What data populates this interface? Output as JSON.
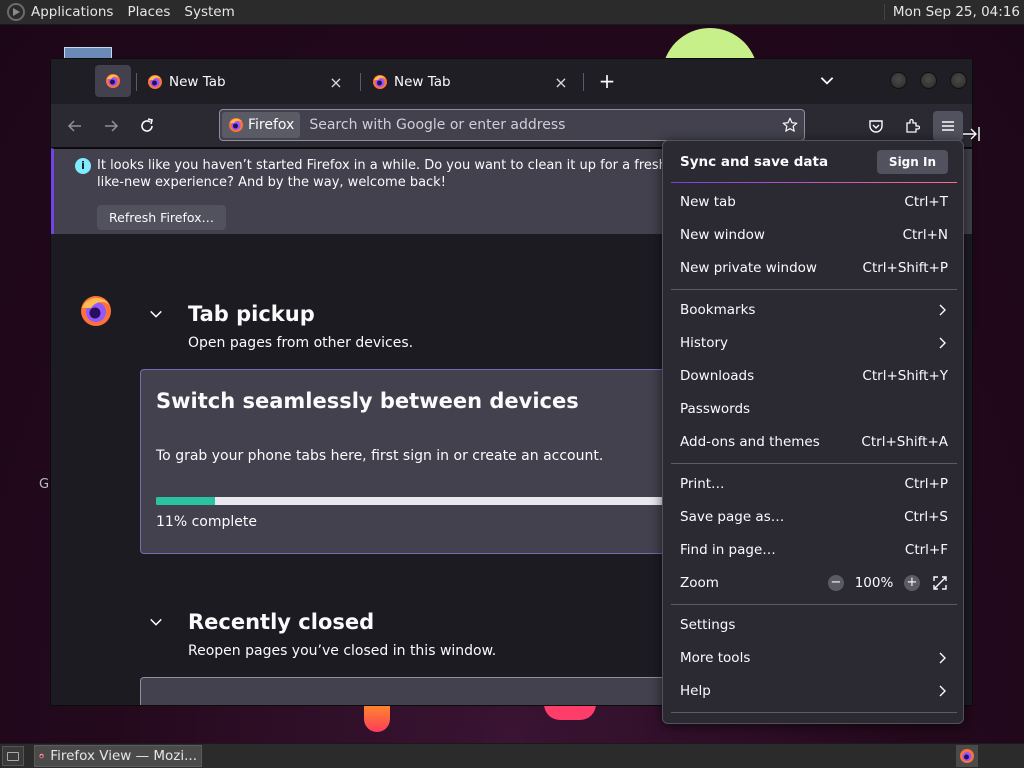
{
  "top_panel": {
    "applications": "Applications",
    "places": "Places",
    "system": "System",
    "clock": "Mon Sep 25, 04:16"
  },
  "bottom_panel": {
    "task_label": "Firefox View — Mozi..."
  },
  "desktop": {
    "icon_label_fragment": "G"
  },
  "browser": {
    "tabs": [
      {
        "title": "New Tab",
        "close": "×"
      },
      {
        "title": "New Tab",
        "close": "×"
      }
    ],
    "new_tab_symbol": "+",
    "identity_label": "Firefox",
    "url_placeholder": "Search with Google or enter address",
    "colors": {
      "accent": "#7542e5",
      "progress": "#2ac3a2",
      "info": "#80ebff"
    }
  },
  "notification": {
    "message": "It looks like you haven’t started Firefox in a while. Do you want to clean it up for a fresh, like-new experience? And by the way, welcome back!",
    "button_label": "Refresh Firefox…"
  },
  "firefox_view": {
    "tab_pickup": {
      "title": "Tab pickup",
      "subtitle": "Open pages from other devices.",
      "card_title": "Switch seamlessly between devices",
      "card_body": "To grab your phone tabs here, first sign in or create an account.",
      "progress_percent": 11,
      "progress_label": "11% complete"
    },
    "recently_closed": {
      "title": "Recently closed",
      "subtitle": "Reopen pages you’ve closed in this window."
    }
  },
  "app_menu": {
    "sync_label": "Sync and save data",
    "sign_in_label": "Sign In",
    "items": [
      {
        "label": "New tab",
        "shortcut": "Ctrl+T"
      },
      {
        "label": "New window",
        "shortcut": "Ctrl+N"
      },
      {
        "label": "New private window",
        "shortcut": "Ctrl+Shift+P"
      },
      {
        "label": "Bookmarks",
        "shortcut": ""
      },
      {
        "label": "History",
        "shortcut": ""
      },
      {
        "label": "Downloads",
        "shortcut": "Ctrl+Shift+Y"
      },
      {
        "label": "Passwords",
        "shortcut": ""
      },
      {
        "label": "Add-ons and themes",
        "shortcut": "Ctrl+Shift+A"
      },
      {
        "label": "Print…",
        "shortcut": "Ctrl+P"
      },
      {
        "label": "Save page as…",
        "shortcut": "Ctrl+S"
      },
      {
        "label": "Find in page…",
        "shortcut": "Ctrl+F"
      },
      {
        "label": "Zoom",
        "shortcut": ""
      },
      {
        "label": "Settings",
        "shortcut": ""
      },
      {
        "label": "More tools",
        "shortcut": ""
      },
      {
        "label": "Help",
        "shortcut": ""
      }
    ],
    "zoom_minus": "−",
    "zoom_value": "100%",
    "zoom_plus": "+"
  }
}
